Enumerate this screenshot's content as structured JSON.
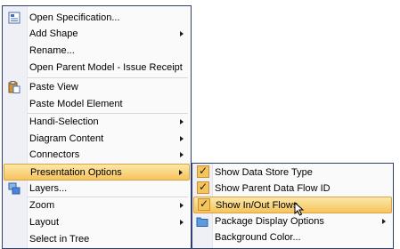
{
  "main_menu": {
    "items": [
      {
        "label": "Open Specification...",
        "icon": "specification-icon",
        "submenu": false
      },
      {
        "label": "Add Shape",
        "submenu": true
      },
      {
        "label": "Rename...",
        "submenu": false
      },
      {
        "label": "Open Parent Model - Issue Receipt",
        "submenu": false
      },
      {
        "label": "Paste View",
        "icon": "clipboard-paste-icon",
        "submenu": false
      },
      {
        "label": "Paste Model Element",
        "submenu": false
      },
      {
        "label": "Handi-Selection",
        "submenu": true
      },
      {
        "label": "Diagram Content",
        "submenu": true
      },
      {
        "label": "Connectors",
        "submenu": true
      },
      {
        "label": "Presentation Options",
        "submenu": true,
        "highlighted": true
      },
      {
        "label": "Layers...",
        "icon": "layers-icon",
        "submenu": false
      },
      {
        "label": "Zoom",
        "submenu": true
      },
      {
        "label": "Layout",
        "submenu": true
      },
      {
        "label": "Select in Tree",
        "submenu": false
      }
    ]
  },
  "sub_menu": {
    "items": [
      {
        "label": "Show Data Store Type",
        "checked": true
      },
      {
        "label": "Show Parent Data Flow ID",
        "checked": true
      },
      {
        "label": "Show In/Out Flows",
        "checked": true,
        "highlighted": true
      },
      {
        "label": "Package Display Options",
        "icon": "folder-icon",
        "submenu": true
      },
      {
        "label": "Background Color...",
        "submenu": false
      }
    ]
  },
  "colors": {
    "highlight_top": "#fce7a8",
    "highlight_bottom": "#f6c45d",
    "menu_border": "#2f3f6e",
    "gutter": "#eef0f5"
  }
}
